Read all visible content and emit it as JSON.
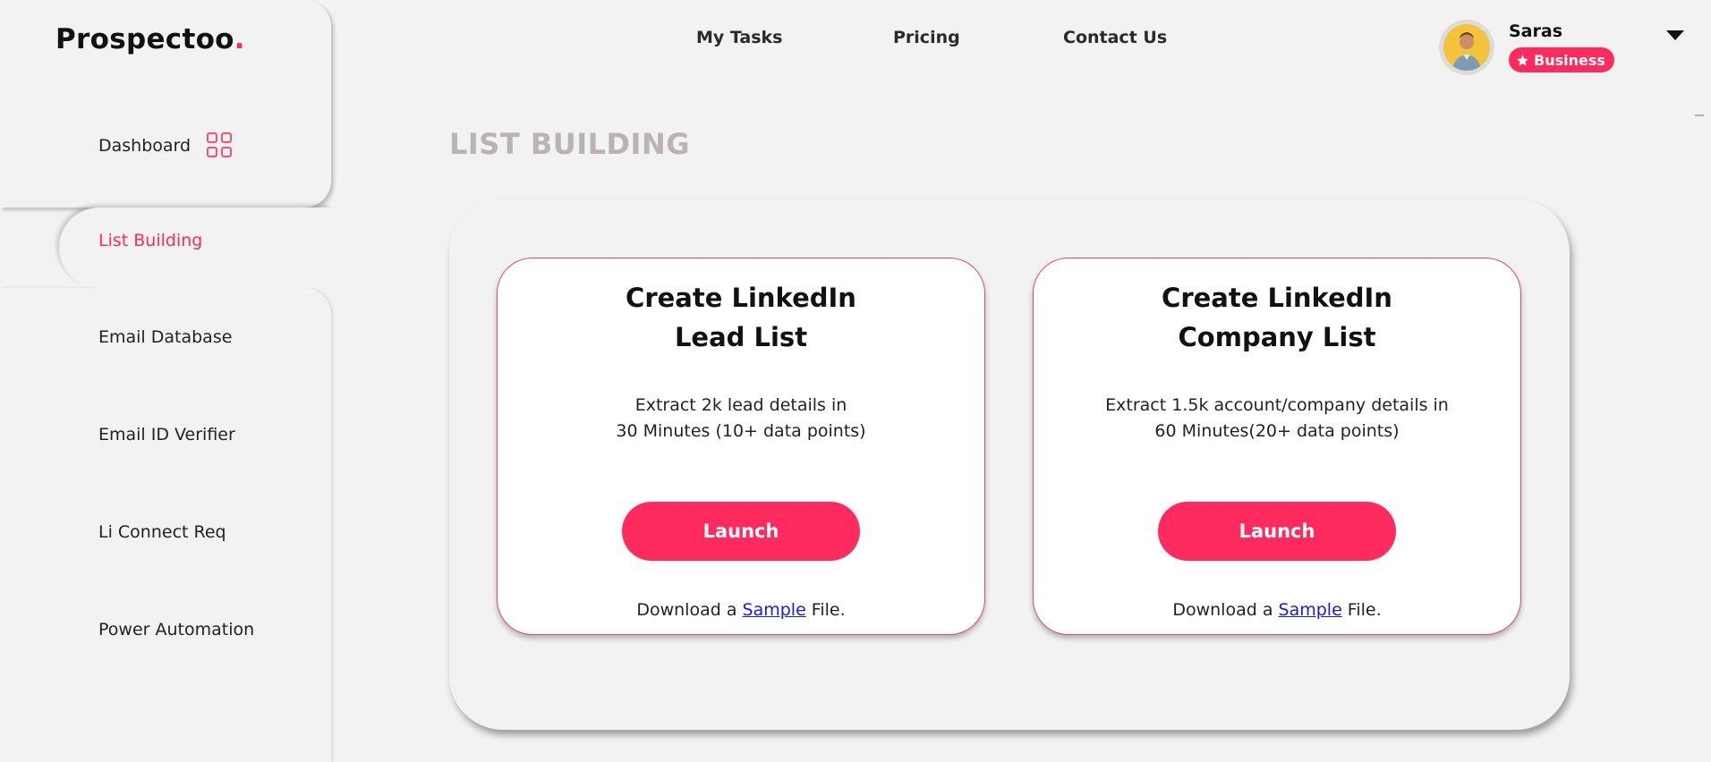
{
  "brand": {
    "name": "Prospectoo",
    "dot": ".",
    "accent": "#ff2a5d"
  },
  "sidebar": {
    "items": [
      {
        "label": "Dashboard"
      },
      {
        "label": "List Building",
        "active": true
      },
      {
        "label": "Email Database"
      },
      {
        "label": "Email ID Verifier"
      },
      {
        "label": "Li Connect Req"
      },
      {
        "label": "Power Automation"
      }
    ]
  },
  "topnav": {
    "links": [
      {
        "label": "My Tasks"
      },
      {
        "label": "Pricing"
      },
      {
        "label": "Contact Us"
      }
    ]
  },
  "user": {
    "name": "Saras",
    "plan": "Business",
    "plan_icon": "star-icon"
  },
  "page": {
    "title": "LIST BUILDING"
  },
  "cards": [
    {
      "title_line1": "Create LinkedIn",
      "title_line2": "Lead List",
      "desc_line1": "Extract 2k lead details in",
      "desc_line2": "30 Minutes (10+ data points)",
      "button": "Launch",
      "download_prefix": "Download a ",
      "download_link": "Sample",
      "download_suffix": " File."
    },
    {
      "title_line1": "Create LinkedIn",
      "title_line2": "Company List",
      "desc_line1": "Extract 1.5k account/company details in",
      "desc_line2": "60 Minutes(20+ data points)",
      "button": "Launch",
      "download_prefix": "Download a ",
      "download_link": "Sample",
      "download_suffix": " File."
    }
  ]
}
